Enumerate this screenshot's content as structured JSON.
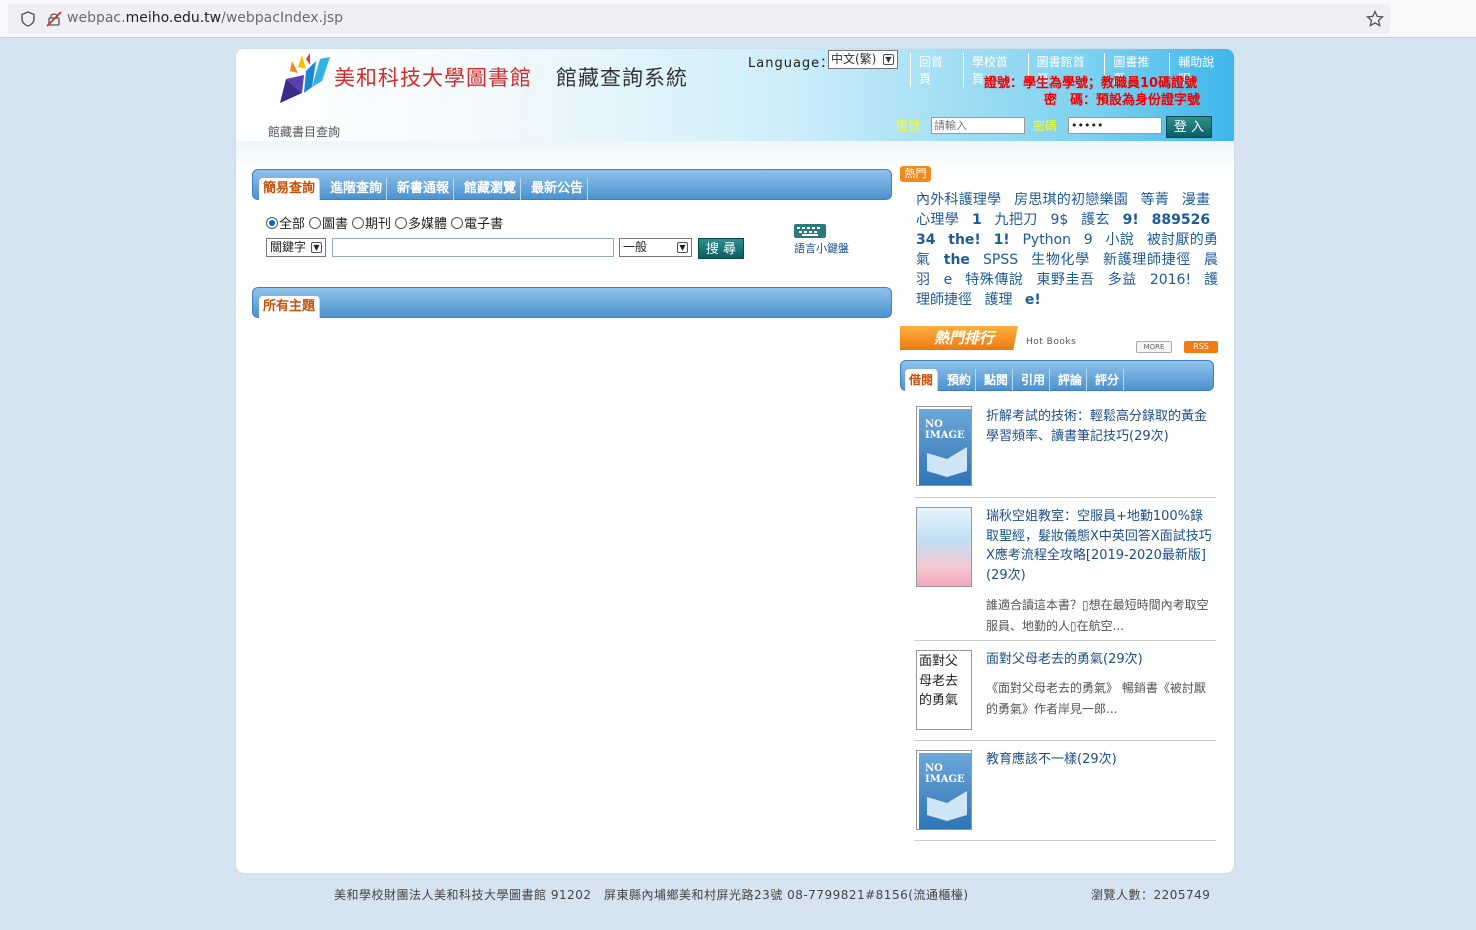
{
  "browser": {
    "url_prefix": "webpac.",
    "url_domain": "meiho.edu.tw",
    "url_path": "/webpacIndex.jsp"
  },
  "header": {
    "school_name": "美和科技大學圖書館",
    "system_name": "館藏查詢系統",
    "subtitle": "館藏書目查詢",
    "language_label": "Language：",
    "language_value": "中文(繁)",
    "top_links": [
      "回首頁",
      "學校首頁",
      "圖書館首頁",
      "圖書推薦",
      "輔助說明"
    ],
    "notice_account": "證號：學生為學號；教職員10碼證號",
    "notice_password": "密　碼：預設為身份證字號",
    "account_label": "證號",
    "account_placeholder": "請輸入",
    "password_label": "密碼",
    "password_value": "•••••",
    "login_label": "登 入"
  },
  "search": {
    "tabs": [
      "簡易查詢",
      "進階查詢",
      "新書通報",
      "館藏瀏覽",
      "最新公告"
    ],
    "types": [
      "全部",
      "圖書",
      "期刊",
      "多媒體",
      "電子書"
    ],
    "field_select": "關鍵字",
    "mode_select": "一般",
    "search_label": "搜 尋",
    "keyboard_label": "語言小鍵盤"
  },
  "topics": {
    "tab": "所有主題"
  },
  "hot": {
    "badge": "熱門",
    "tags": [
      {
        "t": "內外科護理學",
        "b": false
      },
      {
        "t": "房思琪的初戀樂園",
        "b": false
      },
      {
        "t": "等菁",
        "b": false
      },
      {
        "t": "漫畫",
        "b": false
      },
      {
        "t": "心理學",
        "b": false
      },
      {
        "t": "1",
        "b": true
      },
      {
        "t": "九把刀",
        "b": false
      },
      {
        "t": "9$",
        "b": false
      },
      {
        "t": "護玄",
        "b": false
      },
      {
        "t": "9!",
        "b": true
      },
      {
        "t": "889526",
        "b": true
      },
      {
        "t": "34",
        "b": true
      },
      {
        "t": "the!",
        "b": true
      },
      {
        "t": "1!",
        "b": true
      },
      {
        "t": "Python",
        "b": false
      },
      {
        "t": "9",
        "b": false
      },
      {
        "t": "小說",
        "b": false
      },
      {
        "t": "被討厭的勇氣",
        "b": false
      },
      {
        "t": "the",
        "b": true
      },
      {
        "t": "SPSS",
        "b": false
      },
      {
        "t": "生物化學",
        "b": false
      },
      {
        "t": "新護理師捷徑",
        "b": false
      },
      {
        "t": "晨羽",
        "b": false
      },
      {
        "t": "e",
        "b": false
      },
      {
        "t": "特殊傳說",
        "b": false
      },
      {
        "t": "東野圭吾",
        "b": false
      },
      {
        "t": "多益",
        "b": false
      },
      {
        "t": "2016!",
        "b": false
      },
      {
        "t": "護理師捷徑",
        "b": false
      },
      {
        "t": "護理",
        "b": false
      },
      {
        "t": "e!",
        "b": true
      }
    ],
    "rank_title": "熱門排行",
    "hotbooks_label": "Hot Books",
    "more_label": "MORE",
    "rss_label": "RSS",
    "rank_tabs": [
      "借閱",
      "預約",
      "點閱",
      "引用",
      "評論",
      "評分"
    ],
    "no_image_label": "NO IMAGE",
    "books": [
      {
        "title": "折解考試的技術：輕鬆高分錄取的黃金學習頻率、讀書筆記技巧(29次)",
        "desc": "",
        "cover": "none"
      },
      {
        "title": "瑞秋空姐教室：空服員+地勤100%錄取聖經，髮妝儀態X中英回答X面試技巧X應考流程全攻略[2019-2020最新版](29次)",
        "desc": "誰適合讀這本書？▯想在最短時間內考取空服員、地勤的人▯在航空...",
        "cover": "photo"
      },
      {
        "title": "面對父母老去的勇氣(29次)",
        "desc": "《面對父母老去的勇氣》 暢銷書《被討厭的勇氣》作者岸見一郎...",
        "cover": "text",
        "cover_text": "面對父母老去的勇氣"
      },
      {
        "title": "教育應該不一樣(29次)",
        "desc": "",
        "cover": "none"
      }
    ]
  },
  "footer": {
    "address": "美和學校財團法人美和科技大學圖書館 91202　屏東縣內埔鄉美和村屏光路23號 08-7799821#8156(流通櫃檯)",
    "visitors": "瀏覽人數：2205749"
  },
  "colors": {
    "accent_red": "#d42b2b",
    "tab_blue": "#4c92cf",
    "active_tab_text": "#c9500b",
    "link_blue": "#1d5b98"
  }
}
